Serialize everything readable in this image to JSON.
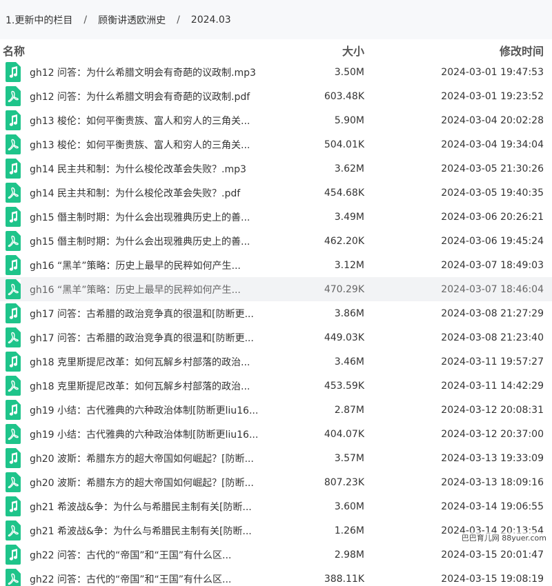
{
  "breadcrumb": {
    "items": [
      "1.更新中的栏目",
      "顾衡讲透欧洲史",
      "2024.03"
    ],
    "separator": "/"
  },
  "columns": {
    "name": "名称",
    "size": "大小",
    "time": "修改时间"
  },
  "colors": {
    "icon_green": "#1ec48a",
    "hover_bg": "#f2f3f5",
    "breadcrumb_bg": "#f7f8fa"
  },
  "files": [
    {
      "name": "gh12 问答：为什么希腊文明会有奇葩的议政制.mp3",
      "size": "3.50M",
      "time": "2024-03-01 19:47:53",
      "type": "audio"
    },
    {
      "name": "gh12 问答：为什么希腊文明会有奇葩的议政制.pdf",
      "size": "603.48K",
      "time": "2024-03-01 19:23:52",
      "type": "pdf"
    },
    {
      "name": "gh13 梭伦：如何平衡贵族、富人和穷人的三角关...",
      "size": "5.90M",
      "time": "2024-03-04 20:02:28",
      "type": "audio"
    },
    {
      "name": "gh13 梭伦：如何平衡贵族、富人和穷人的三角关...",
      "size": "504.01K",
      "time": "2024-03-04 19:34:04",
      "type": "pdf"
    },
    {
      "name": "gh14 民主共和制：为什么梭伦改革会失败？.mp3",
      "size": "3.62M",
      "time": "2024-03-05 21:30:26",
      "type": "audio"
    },
    {
      "name": "gh14 民主共和制：为什么梭伦改革会失败？.pdf",
      "size": "454.68K",
      "time": "2024-03-05 19:40:35",
      "type": "pdf"
    },
    {
      "name": "gh15 僭主制时期：为什么会出现雅典历史上的善...",
      "size": "3.49M",
      "time": "2024-03-06 20:26:21",
      "type": "audio"
    },
    {
      "name": "gh15 僭主制时期：为什么会出现雅典历史上的善...",
      "size": "462.20K",
      "time": "2024-03-06 19:45:24",
      "type": "pdf"
    },
    {
      "name": "gh16 “黑羊”策略：历史上最早的民粹如何产生...",
      "size": "3.12M",
      "time": "2024-03-07 18:49:03",
      "type": "audio"
    },
    {
      "name": "gh16 “黑羊”策略：历史上最早的民粹如何产生...",
      "size": "470.29K",
      "time": "2024-03-07 18:46:04",
      "type": "pdf",
      "hover": true
    },
    {
      "name": "gh17 问答：古希腊的政治竞争真的很温和[防断更...",
      "size": "3.86M",
      "time": "2024-03-08 21:27:29",
      "type": "audio"
    },
    {
      "name": "gh17 问答：古希腊的政治竞争真的很温和[防断更...",
      "size": "449.03K",
      "time": "2024-03-08 21:23:40",
      "type": "pdf"
    },
    {
      "name": "gh18 克里斯提尼改革：如何瓦解乡村部落的政治...",
      "size": "3.46M",
      "time": "2024-03-11 19:57:27",
      "type": "audio"
    },
    {
      "name": "gh18 克里斯提尼改革：如何瓦解乡村部落的政治...",
      "size": "453.59K",
      "time": "2024-03-11 14:42:29",
      "type": "pdf"
    },
    {
      "name": "gh19 小结：古代雅典的六种政治体制[防断更liu16...",
      "size": "2.87M",
      "time": "2024-03-12 20:08:31",
      "type": "audio"
    },
    {
      "name": "gh19 小结：古代雅典的六种政治体制[防断更liu16...",
      "size": "404.07K",
      "time": "2024-03-12 20:37:00",
      "type": "pdf"
    },
    {
      "name": "gh20 波斯：希腊东方的超大帝国如何崛起？[防断...",
      "size": "3.57M",
      "time": "2024-03-13 19:33:09",
      "type": "audio"
    },
    {
      "name": "gh20 波斯：希腊东方的超大帝国如何崛起？[防断...",
      "size": "807.23K",
      "time": "2024-03-13 18:09:16",
      "type": "pdf"
    },
    {
      "name": "gh21 希波战&争：为什么与希腊民主制有关[防断...",
      "size": "3.60M",
      "time": "2024-03-14 19:06:55",
      "type": "audio"
    },
    {
      "name": "gh21 希波战&争：为什么与希腊民主制有关[防断...",
      "size": "1.26M",
      "time": "2024-03-14 20:13:54",
      "type": "pdf"
    },
    {
      "name": "gh22 问答：古代的“帝国”和“王国”有什么区...",
      "size": "2.98M",
      "time": "2024-03-15 20:01:47",
      "type": "audio"
    },
    {
      "name": "gh22 问答：古代的“帝国”和“王国”有什么区...",
      "size": "388.11K",
      "time": "2024-03-15 19:08:19",
      "type": "pdf"
    }
  ],
  "watermark": "巴巴育儿网 88yuer.com"
}
